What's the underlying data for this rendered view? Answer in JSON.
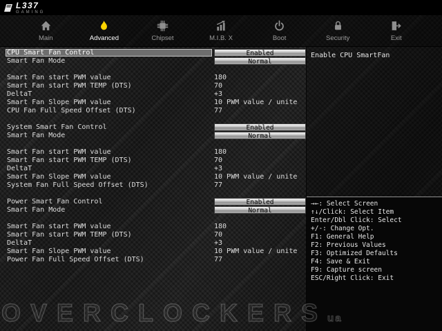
{
  "logo": {
    "brand": "L337",
    "tagline": "GAMING"
  },
  "menu": {
    "tabs": [
      {
        "label": "Main",
        "icon": "home-icon",
        "active": false
      },
      {
        "label": "Advanced",
        "icon": "flame-icon",
        "active": true
      },
      {
        "label": "Chipset",
        "icon": "chip-icon",
        "active": false
      },
      {
        "label": "M.I.B. X",
        "icon": "chart-icon",
        "active": false
      },
      {
        "label": "Boot",
        "icon": "power-icon",
        "active": false
      },
      {
        "label": "Security",
        "icon": "lock-icon",
        "active": false
      },
      {
        "label": "Exit",
        "icon": "exit-icon",
        "active": false
      }
    ]
  },
  "settings": {
    "rows": [
      {
        "type": "option",
        "label": "CPU Smart Fan Control",
        "value": "Enabled",
        "selected": true
      },
      {
        "type": "option",
        "label": "Smart Fan Mode",
        "value": "Normal"
      },
      {
        "type": "spacer"
      },
      {
        "type": "text",
        "label": "Smart Fan start PWM value",
        "value": "180"
      },
      {
        "type": "text",
        "label": "Smart Fan start PWM TEMP (DTS)",
        "value": "70"
      },
      {
        "type": "text",
        "label": "DeltaT",
        "value": "+3"
      },
      {
        "type": "text",
        "label": "Smart Fan Slope PWM value",
        "value": "10 PWM value / unite"
      },
      {
        "type": "text",
        "label": "CPU Fan Full Speed Offset (DTS)",
        "value": "77"
      },
      {
        "type": "spacer"
      },
      {
        "type": "option",
        "label": "System Smart Fan Control",
        "value": "Enabled"
      },
      {
        "type": "option",
        "label": "Smart Fan Mode",
        "value": "Normal"
      },
      {
        "type": "spacer"
      },
      {
        "type": "text",
        "label": "Smart Fan start PWM value",
        "value": "180"
      },
      {
        "type": "text",
        "label": "Smart Fan start PWM TEMP (DTS)",
        "value": "70"
      },
      {
        "type": "text",
        "label": "DeltaT",
        "value": "+3"
      },
      {
        "type": "text",
        "label": "Smart Fan Slope PWM value",
        "value": "10 PWM value / unite"
      },
      {
        "type": "text",
        "label": "System Fan Full Speed Offset (DTS)",
        "value": "77"
      },
      {
        "type": "spacer"
      },
      {
        "type": "option",
        "label": "Power Smart Fan Control",
        "value": "Enabled"
      },
      {
        "type": "option",
        "label": "Smart Fan Mode",
        "value": "Normal"
      },
      {
        "type": "spacer"
      },
      {
        "type": "text",
        "label": "Smart Fan start PWM value",
        "value": "180"
      },
      {
        "type": "text",
        "label": "Smart Fan start PWM TEMP (DTS)",
        "value": "70"
      },
      {
        "type": "text",
        "label": "DeltaT",
        "value": "+3"
      },
      {
        "type": "text",
        "label": "Smart Fan Slope PWM value",
        "value": "10 PWM value / unite"
      },
      {
        "type": "text",
        "label": "Power Fan Full Speed Offset (DTS)",
        "value": "77"
      }
    ]
  },
  "help": {
    "item_help": "Enable CPU SmartFan"
  },
  "keyhelp": {
    "lines": [
      "→←: Select Screen",
      "↑↓/Click: Select Item",
      "Enter/Dbl Click: Select",
      "+/-: Change Opt.",
      "F1: General Help",
      "F2: Previous Values",
      "F3: Optimized Defaults",
      "F4: Save & Exit",
      "F9: Capture screen",
      "ESC/Right Click: Exit"
    ]
  },
  "watermark": {
    "main": "OVERCLOCKERS",
    "suffix": "ua"
  },
  "colors": {
    "accent": "#ffd400",
    "button_face": "#bdbdbd",
    "background": "#191919"
  }
}
